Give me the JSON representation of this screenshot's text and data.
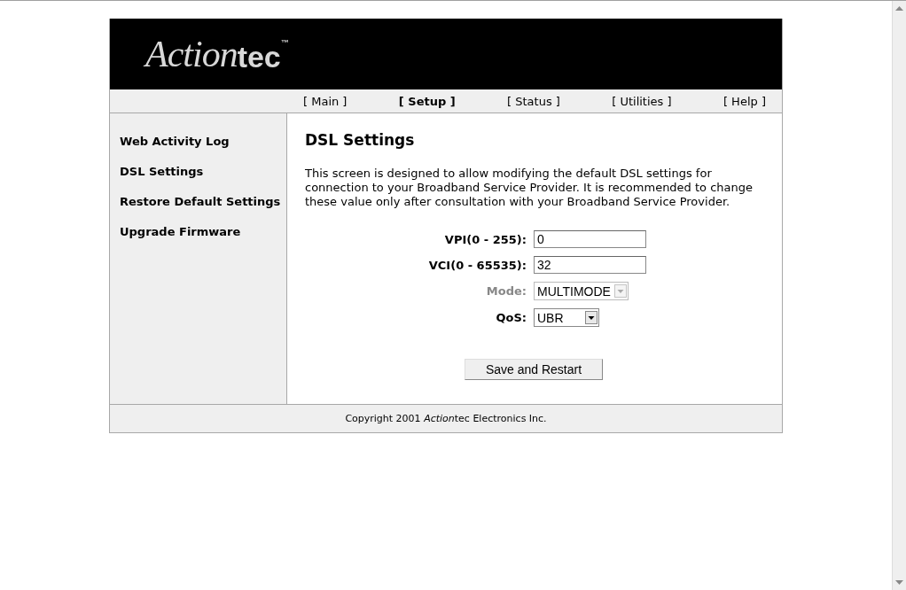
{
  "logo": {
    "part_1": "Action",
    "part_2": "tec",
    "trademark": "™"
  },
  "nav": [
    {
      "label": "[ Main ]",
      "selected": false
    },
    {
      "label": "[ Setup ]",
      "selected": true
    },
    {
      "label": "[ Status ]",
      "selected": false
    },
    {
      "label": "[ Utilities ]",
      "selected": false
    },
    {
      "label": "[ Help ]",
      "selected": false
    }
  ],
  "sidebar": {
    "items": [
      "Web Activity Log",
      "DSL Settings",
      "Restore Default Settings",
      "Upgrade Firmware"
    ]
  },
  "content": {
    "title": "DSL Settings",
    "description": "This screen is designed to allow modifying the default DSL settings for connection to your Broadband Service Provider. It is recommended to change these value only after consultation with your Broadband Service Provider.",
    "fields": [
      {
        "kind": "text",
        "label": "VPI(0 - 255):",
        "value": "0",
        "disabled": false
      },
      {
        "kind": "text",
        "label": "VCI(0 - 65535):",
        "value": "32",
        "disabled": false
      },
      {
        "kind": "select",
        "label": "Mode:",
        "value": "MULTIMODE",
        "disabled": true
      },
      {
        "kind": "select",
        "label": "QoS:",
        "value": "UBR",
        "disabled": false
      }
    ],
    "button": "Save and Restart"
  },
  "footer": {
    "prefix": "Copyright 2001 ",
    "brand_italic": "Action",
    "rest": "tec Electronics Inc."
  }
}
